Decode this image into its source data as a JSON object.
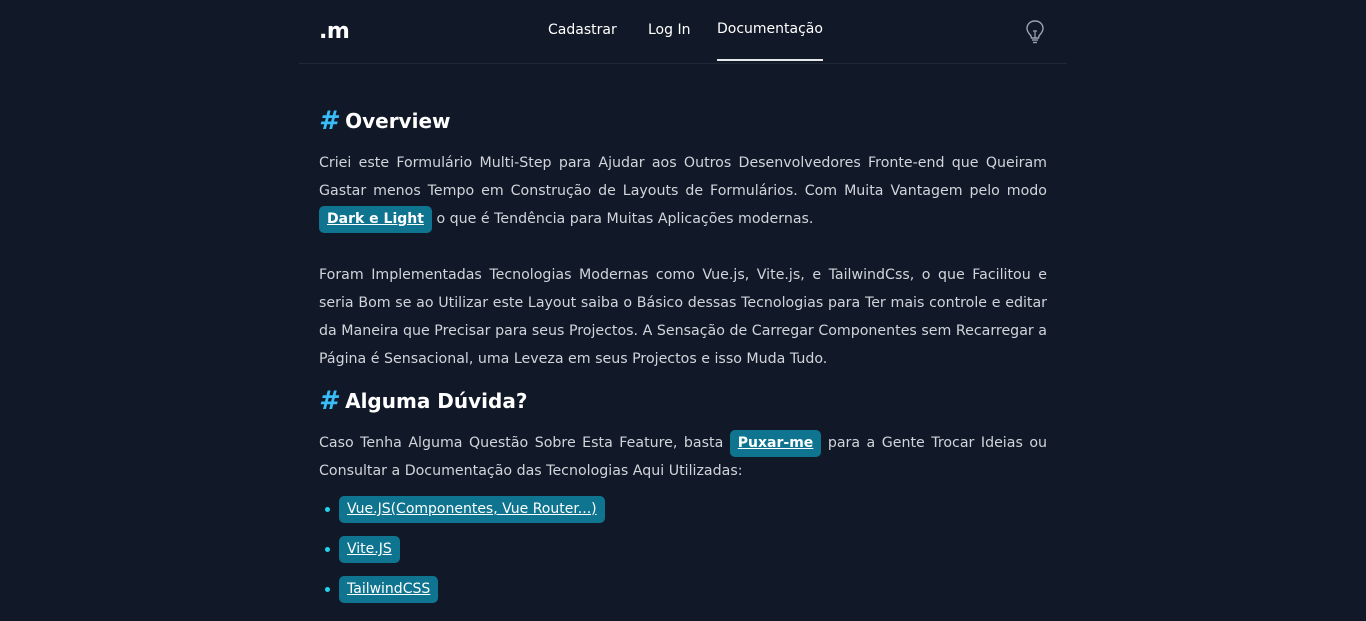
{
  "header": {
    "logo": ".m",
    "nav": [
      {
        "label": "Cadastrar"
      },
      {
        "label": "Log In"
      },
      {
        "label": "Documentação"
      }
    ],
    "theme_icon": "lightbulb-icon"
  },
  "overview": {
    "title": "Overview",
    "hash": "#",
    "p1_before": "Criei este Formulário Multi-Step para Ajudar aos Outros Desenvolvedores Fronte-end que Queiram Gastar menos Tempo em Construção de Layouts de Formulários. Com Muita Vantagem pelo modo",
    "p1_link": "Dark e Light",
    "p1_after": "o que é Tendência para Muitas Aplicações modernas.",
    "p2": "Foram Implementadas Tecnologias Modernas como Vue.js, Vite.js, e TailwindCss, o que Facilitou e seria Bom se ao Utilizar este Layout saiba o Básico dessas Tecnologias para Ter mais controle e editar da Maneira que Precisar para seus Projectos. A Sensação de Carregar Componentes sem Recarregar a Página é Sensacional, uma Leveza em seus Projectos e isso Muda Tudo."
  },
  "doubt": {
    "title": "Alguma Dúvida?",
    "hash": "#",
    "p_before": "Caso Tenha Alguma Questão Sobre Esta Feature, basta",
    "p_link": "Puxar-me",
    "p_after": "para a Gente Trocar Ideias ou Consultar a Documentação das Tecnologias Aqui Utilizadas:",
    "links": [
      {
        "label": "Vue.JS(Componentes, Vue Router...)"
      },
      {
        "label": "Vite.JS"
      },
      {
        "label": "TailwindCSS"
      }
    ]
  },
  "colors": {
    "background": "#111827",
    "accent": "#38bdf8",
    "tag_bg": "#0e7490"
  }
}
